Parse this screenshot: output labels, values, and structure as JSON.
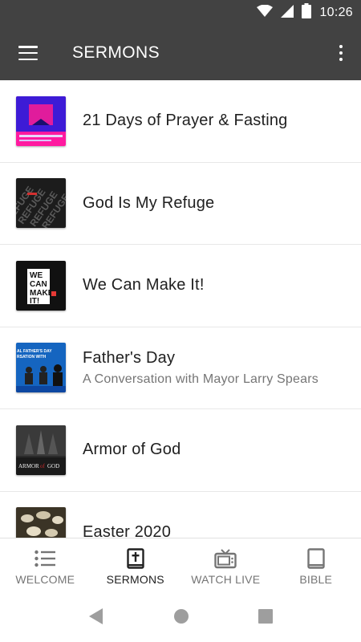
{
  "status_bar": {
    "time": "10:26"
  },
  "app_bar": {
    "title": "SERMONS"
  },
  "sermons": [
    {
      "title": "21 Days of Prayer & Fasting",
      "subtitle": ""
    },
    {
      "title": "God Is My Refuge",
      "subtitle": ""
    },
    {
      "title": "We Can Make It!",
      "subtitle": ""
    },
    {
      "title": "Father's Day",
      "subtitle": "A Conversation with Mayor Larry Spears"
    },
    {
      "title": "Armor of God",
      "subtitle": ""
    },
    {
      "title": "Easter 2020",
      "subtitle": ""
    }
  ],
  "thumb_text": {
    "refuge": "REFUGE",
    "we": "WE",
    "can": "CAN",
    "make": "MAKE",
    "it": "IT!",
    "fathers_line1": "AL FATHER'S DAY",
    "fathers_line2": "RSATION WITH",
    "armor": "ARMOR",
    "of": "of",
    "god": "GOD"
  },
  "bottom_nav": [
    {
      "label": "WELCOME",
      "icon": "list-icon",
      "active": false
    },
    {
      "label": "SERMONS",
      "icon": "bible-cross-icon",
      "active": true
    },
    {
      "label": "WATCH LIVE",
      "icon": "tv-icon",
      "active": false
    },
    {
      "label": "BIBLE",
      "icon": "book-icon",
      "active": false
    }
  ],
  "colors": {
    "app_bar": "#424242",
    "active_nav": "#212121",
    "inactive_nav": "#757575"
  }
}
